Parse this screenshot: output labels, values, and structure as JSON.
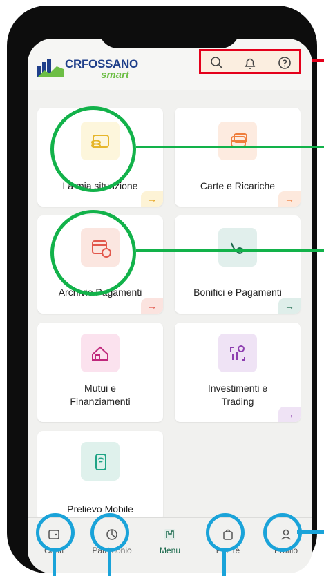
{
  "brand": {
    "name": "CRFOSSANO",
    "sub": "smart"
  },
  "header_icons": [
    "search-icon",
    "bell-icon",
    "help-icon"
  ],
  "cards": [
    {
      "label": "La mia situazione",
      "icon": "wallet-coins-icon",
      "arrow": "→"
    },
    {
      "label": "Carte e Ricariche",
      "icon": "cards-icon",
      "arrow": "→"
    },
    {
      "label": "Archivio Pagamenti",
      "icon": "calendar-icon",
      "arrow": "→"
    },
    {
      "label": "Bonifici e Pagamenti",
      "icon": "transfer-hand-icon",
      "arrow": "→"
    },
    {
      "label": "Mutui e\nFinanziamenti",
      "icon": "house-like-icon",
      "arrow": ""
    },
    {
      "label": "Investimenti e\nTrading",
      "icon": "chart-search-icon",
      "arrow": "→"
    },
    {
      "label": "Prelievo Mobile",
      "icon": "phone-contactless-icon",
      "arrow": ""
    }
  ],
  "nav": [
    {
      "label": "Conti",
      "icon": "wallet-icon"
    },
    {
      "label": "Patrimonio",
      "icon": "pie-icon"
    },
    {
      "label": "Menu",
      "icon": "menu-icon"
    },
    {
      "label": "Per Te",
      "icon": "bag-icon"
    },
    {
      "label": "Profilo",
      "icon": "user-icon"
    }
  ],
  "colors": {
    "accent_green": "#12b24a",
    "accent_red": "#e4001b",
    "accent_blue": "#1aa3d9",
    "brand_blue": "#1f3f8a"
  }
}
